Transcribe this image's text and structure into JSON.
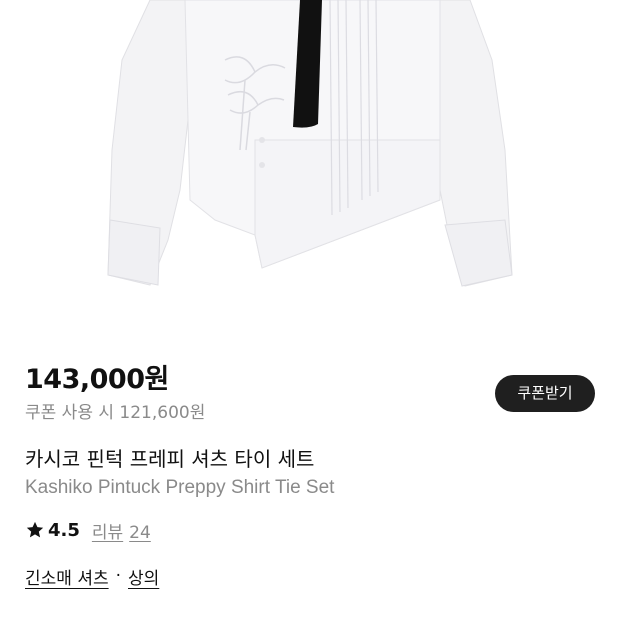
{
  "product": {
    "image_alt": "Kashiko Pintuck Preppy Shirt Tie Set",
    "price": "143,000원",
    "coupon_price": "쿠폰 사용 시 121,600원",
    "coupon_button_label": "쿠폰받기",
    "name_ko": "카시코 핀턱 프레피 셔츠 타이 세트",
    "name_en": "Kashiko Pintuck Preppy Shirt Tie Set",
    "rating": "4.5",
    "review_label": "리뷰",
    "review_count": "24",
    "categories": [
      {
        "label": "긴소매 셔츠"
      },
      {
        "label": "상의"
      }
    ],
    "category_separator": "·"
  },
  "icons": {
    "rating": "star-icon"
  },
  "colors": {
    "primary_text": "#111111",
    "secondary_text": "#8a8a8a",
    "coupon_button_bg": "#1f1f1f",
    "coupon_button_text": "#ffffff",
    "tie": "#111111"
  }
}
